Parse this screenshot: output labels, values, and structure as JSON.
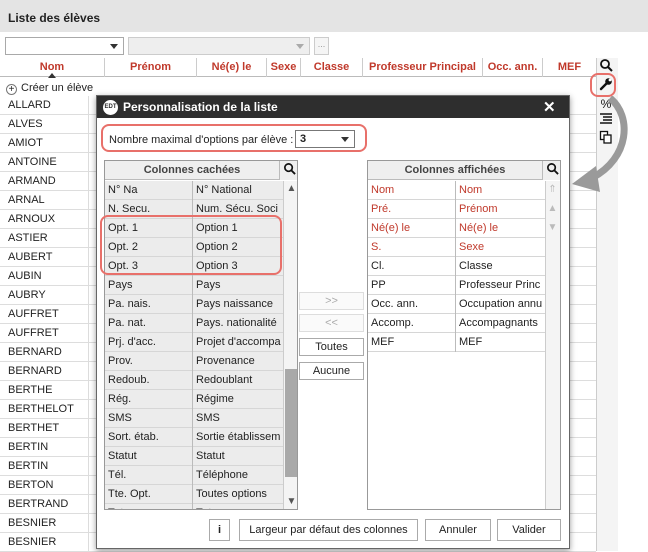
{
  "window": {
    "title": "Liste des élèves"
  },
  "filters": {
    "select1": "",
    "select2": "",
    "dots": "..."
  },
  "columns": [
    "Nom",
    "Prénom",
    "Né(e) le",
    "Sexe",
    "Classe",
    "Professeur Principal",
    "Occ. ann.",
    "MEF"
  ],
  "create_label": "Créer un élève",
  "students": [
    "ALLARD",
    "ALVES",
    "AMIOT",
    "ANTOINE",
    "ARMAND",
    "ARNAL",
    "ARNOUX",
    "ASTIER",
    "AUBERT",
    "AUBIN",
    "AUBRY",
    "AUFFRET",
    "AUFFRET",
    "BERNARD",
    "BERNARD",
    "BERTHE",
    "BERTHELOT",
    "BERTHET",
    "BERTIN",
    "BERTIN",
    "BERTON",
    "BERTRAND",
    "BESNIER",
    "BESNIER"
  ],
  "toolbar": {
    "icons": [
      "search-icon",
      "wrench-icon",
      "percent-icon",
      "list-icon",
      "copy-icon"
    ]
  },
  "dialog": {
    "title": "Personnalisation de la liste",
    "logo": "EDT",
    "close": "✕",
    "max_options_label": "Nombre maximal d'options par élève  :",
    "max_options_value": "3",
    "hidden_title": "Colonnes cachées",
    "hidden_rows": [
      [
        "N° Na",
        "N° National"
      ],
      [
        "N. Secu.",
        "Num. Sécu. Soci"
      ],
      [
        "Opt. 1",
        "Option 1"
      ],
      [
        "Opt. 2",
        "Option 2"
      ],
      [
        "Opt. 3",
        "Option 3"
      ],
      [
        "Pays",
        "Pays"
      ],
      [
        "Pa. nais.",
        "Pays naissance"
      ],
      [
        "Pa. nat.",
        "Pays. nationalité"
      ],
      [
        "Prj. d'acc.",
        "Projet d'accompa"
      ],
      [
        "Prov.",
        "Provenance"
      ],
      [
        "Redoub.",
        "Redoublant"
      ],
      [
        "Rég.",
        "Régime"
      ],
      [
        "SMS",
        "SMS"
      ],
      [
        "Sort. étab.",
        "Sortie établissem"
      ],
      [
        "Statut",
        "Statut"
      ],
      [
        "Tél.",
        "Téléphone"
      ],
      [
        "Tte. Opt.",
        "Toutes options"
      ],
      [
        "Tuteur",
        "Tuteur"
      ]
    ],
    "shown_title": "Colonnes affichées",
    "shown_rows": [
      [
        "Nom",
        "Nom"
      ],
      [
        "Pré.",
        "Prénom"
      ],
      [
        "Né(e) le",
        "Né(e) le"
      ],
      [
        "S.",
        "Sexe"
      ],
      [
        "Cl.",
        "Classe"
      ],
      [
        "PP",
        "Professeur Princ"
      ],
      [
        "Occ. ann.",
        "Occupation annu"
      ],
      [
        "Accomp.",
        "Accompagnants"
      ],
      [
        "MEF",
        "MEF"
      ]
    ],
    "move_right": ">>",
    "move_left": "<<",
    "all_button": "Toutes",
    "none_button": "Aucune",
    "info_button": "i",
    "default_width_button": "Largeur par défaut des colonnes",
    "cancel_button": "Annuler",
    "validate_button": "Valider"
  }
}
